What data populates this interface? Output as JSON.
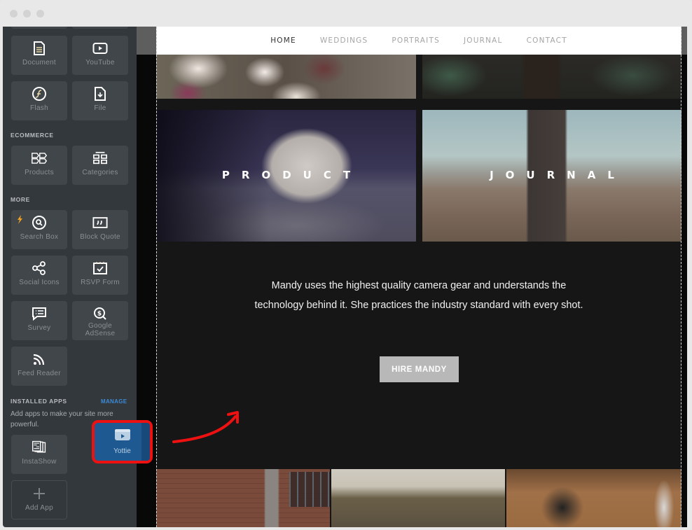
{
  "window": {
    "traffic_lights": [
      "close",
      "minimize",
      "maximize"
    ]
  },
  "sidebar": {
    "sections": [
      {
        "label": "",
        "tiles": [
          {
            "label": "Document",
            "icon": "document-icon"
          },
          {
            "label": "YouTube",
            "icon": "youtube-icon"
          },
          {
            "label": "Flash",
            "icon": "flash-icon"
          },
          {
            "label": "File",
            "icon": "file-icon"
          }
        ]
      },
      {
        "label": "ECOMMERCE",
        "tiles": [
          {
            "label": "Products",
            "icon": "products-icon"
          },
          {
            "label": "Categories",
            "icon": "categories-icon"
          }
        ]
      },
      {
        "label": "MORE",
        "tiles": [
          {
            "label": "Search Box",
            "icon": "search-icon",
            "badge": "lightning-icon"
          },
          {
            "label": "Block Quote",
            "icon": "quote-icon"
          },
          {
            "label": "Social Icons",
            "icon": "share-icon"
          },
          {
            "label": "RSVP Form",
            "icon": "calendar-check-icon"
          },
          {
            "label": "Survey",
            "icon": "survey-icon"
          },
          {
            "label": "Google AdSense",
            "label_lines": [
              "Google",
              "AdSense"
            ],
            "icon": "adsense-icon"
          },
          {
            "label": "Feed Reader",
            "icon": "rss-icon"
          }
        ]
      }
    ],
    "installed_apps": {
      "label": "INSTALLED APPS",
      "manage_label": "MANAGE",
      "description": "Add apps to make your site more powerful.",
      "apps": [
        {
          "label": "InstaShow",
          "icon": "instashow-icon"
        }
      ],
      "add_app_label": "Add App"
    },
    "dragging_app": {
      "label": "Yottie",
      "icon": "yottie-icon"
    }
  },
  "site": {
    "nav": {
      "items": [
        {
          "label": "HOME",
          "active": true
        },
        {
          "label": "WEDDINGS",
          "active": false
        },
        {
          "label": "PORTRAITS",
          "active": false
        },
        {
          "label": "JOURNAL",
          "active": false
        },
        {
          "label": "CONTACT",
          "active": false
        }
      ]
    },
    "feature_tiles": [
      {
        "title": "PRODUCT"
      },
      {
        "title": "JOURNAL"
      }
    ],
    "tagline": {
      "line1": "Mandy uses the highest quality camera gear and understands the",
      "line2": "technology behind it. She practices the industry standard with every shot."
    },
    "cta_label": "HIRE MANDY"
  },
  "colors": {
    "sidebar_bg": "#33383c",
    "tile_bg": "#41464a",
    "accent_blue": "#3d8ad6",
    "drag_tile_bg": "#1e5a91",
    "annotation_red": "#ee1111",
    "site_bg": "#161616",
    "cta_bg": "#b8b8b8"
  }
}
